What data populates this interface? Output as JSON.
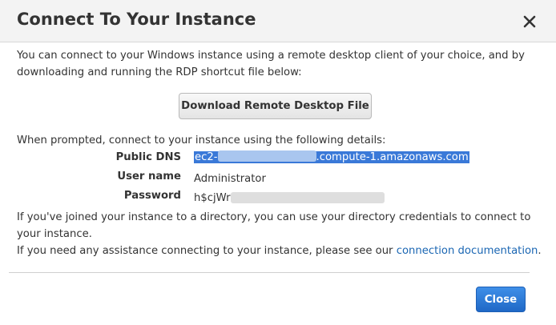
{
  "dialog": {
    "title": "Connect To Your Instance",
    "close_icon": "close-x-icon"
  },
  "content": {
    "intro": "You can connect to your Windows instance using a remote desktop client of your choice, and by downloading and running the RDP shortcut file below:",
    "download_button": "Download Remote Desktop File",
    "prompted": "When prompted, connect to your instance using the following details:",
    "details": {
      "dns_label": "Public DNS",
      "dns_prefix": "ec2-",
      "dns_suffix": ".compute-1.amazonaws.com",
      "username_label": "User name",
      "username_value": "Administrator",
      "password_label": "Password",
      "password_prefix": "h$cjWr"
    },
    "directory": "If you've joined your instance to a directory, you can use your directory credentials to connect to your instance.",
    "assist_text": "If you need any assistance connecting to your instance, please see our",
    "assist_link": "connection documentation",
    "assist_end": "."
  },
  "footer": {
    "close_button": "Close"
  },
  "colors": {
    "accent": "#2a74d5",
    "link": "#1a66b3",
    "selection": "#3a79d8"
  }
}
